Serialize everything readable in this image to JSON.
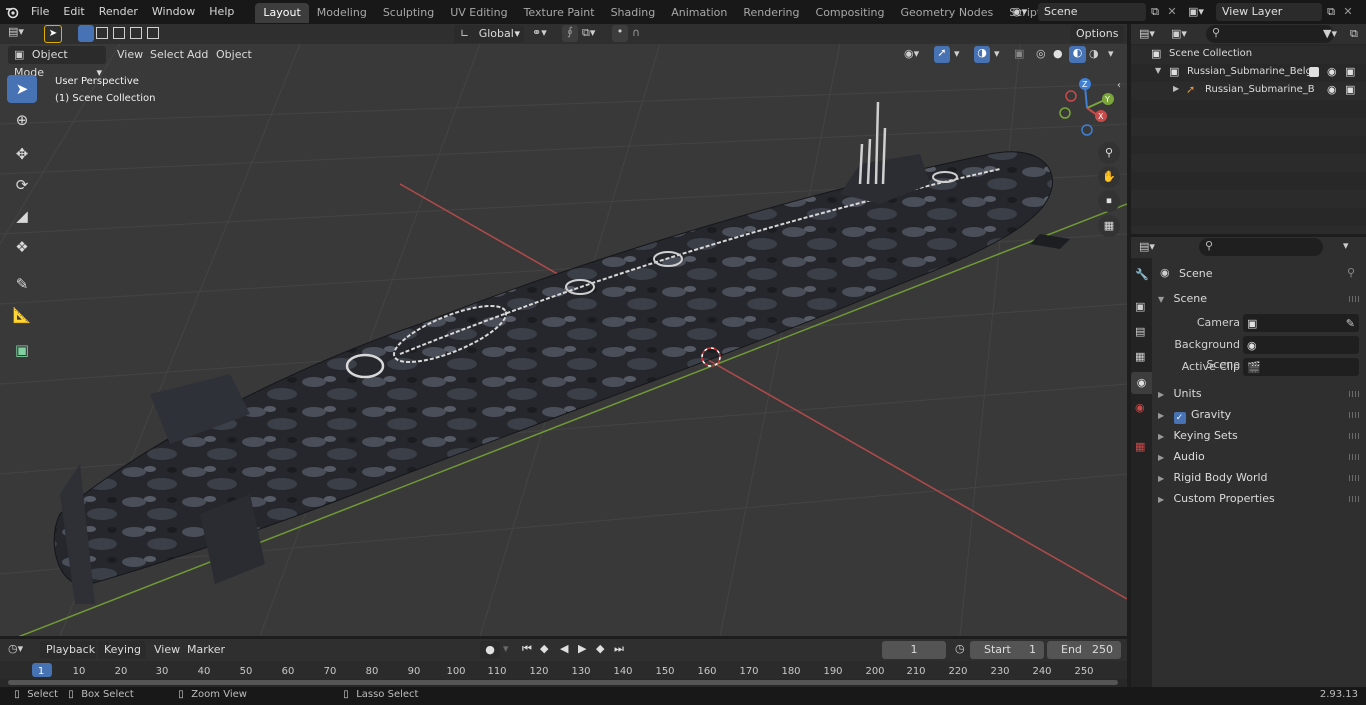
{
  "menus": [
    "File",
    "Edit",
    "Render",
    "Window",
    "Help"
  ],
  "workspaces": [
    {
      "label": "Layout",
      "active": true
    },
    {
      "label": "Modeling"
    },
    {
      "label": "Sculpting"
    },
    {
      "label": "UV Editing"
    },
    {
      "label": "Texture Paint"
    },
    {
      "label": "Shading"
    },
    {
      "label": "Animation"
    },
    {
      "label": "Rendering"
    },
    {
      "label": "Compositing"
    },
    {
      "label": "Geometry Nodes"
    },
    {
      "label": "Scripting"
    }
  ],
  "scene_field": "Scene",
  "view_layer_field": "View Layer",
  "viewport": {
    "mode": "Object Mode",
    "header_menus": [
      "View",
      "Select",
      "Add",
      "Object"
    ],
    "transform_orientation": "Global",
    "options_label": "Options",
    "overlay_title": "User Perspective",
    "overlay_subtitle": "(1) Scene Collection",
    "gizmo": {
      "x": "X",
      "y": "Y",
      "z": "Z"
    }
  },
  "outliner": {
    "root": "Scene Collection",
    "items": [
      {
        "label": "Russian_Submarine_Belgoroc",
        "level": 1
      },
      {
        "label": "Russian_Submarine_Belç",
        "level": 2
      }
    ]
  },
  "properties": {
    "header": "Scene",
    "section": "Scene",
    "fields": [
      {
        "label": "Camera"
      },
      {
        "label": "Background Scene"
      },
      {
        "label": "Active Clip"
      }
    ],
    "panels": [
      "Units",
      "Gravity",
      "Keying Sets",
      "Audio",
      "Rigid Body World",
      "Custom Properties"
    ]
  },
  "timeline": {
    "menus": [
      "Playback",
      "Keying",
      "View",
      "Marker"
    ],
    "current_frame": "1",
    "start_label": "Start",
    "start_value": "1",
    "end_label": "End",
    "end_value": "250",
    "ticks": [
      "1",
      "10",
      "20",
      "30",
      "40",
      "50",
      "60",
      "70",
      "80",
      "90",
      "100",
      "110",
      "120",
      "130",
      "140",
      "150",
      "160",
      "170",
      "180",
      "190",
      "200",
      "210",
      "220",
      "230",
      "240",
      "250"
    ]
  },
  "statusbar": {
    "items": [
      "Select",
      "Box Select",
      "Zoom View",
      "Lasso Select"
    ],
    "version": "2.93.13"
  },
  "colors": {
    "accent": "#4772b3",
    "x_axis": "#c84a4a",
    "y_axis": "#7aa63a",
    "z_axis": "#3f7fd6"
  }
}
